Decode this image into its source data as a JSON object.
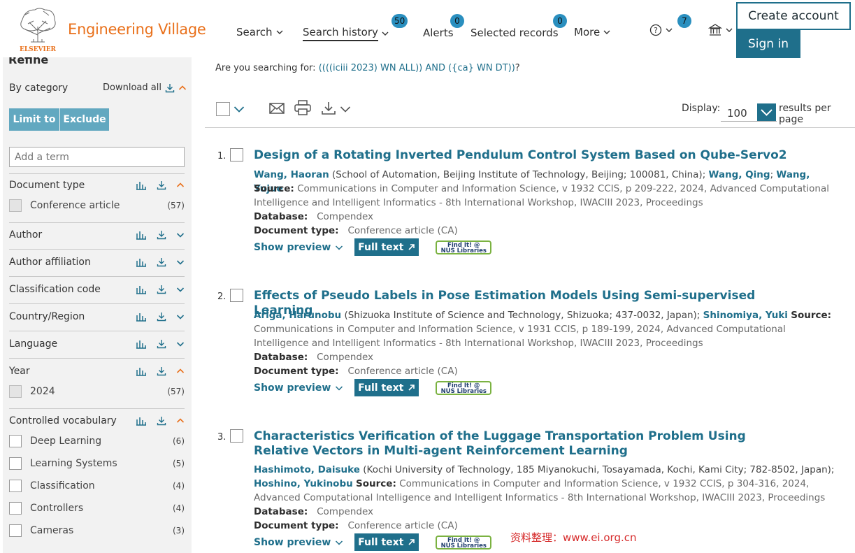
{
  "header": {
    "publisher": "ELSEVIER",
    "brand": "Engineering Village",
    "nav": {
      "search": "Search",
      "search_history": "Search history",
      "search_history_count": "50",
      "alerts": "Alerts",
      "alerts_count": "0",
      "selected_records": "Selected records",
      "selected_records_count": "0",
      "more": "More",
      "help_count": "7"
    },
    "create_account": "Create account",
    "sign_in": "Sign in"
  },
  "sidebar": {
    "title": "Refine",
    "by_category": "By category",
    "download_all": "Download all",
    "limit_to": "Limit to",
    "exclude": "Exclude",
    "add_term_placeholder": "Add a term",
    "facets": {
      "document_type": {
        "title": "Document type",
        "items": [
          {
            "label": "Conference article",
            "count": "(57)"
          }
        ]
      },
      "author": {
        "title": "Author"
      },
      "author_affiliation": {
        "title": "Author affiliation"
      },
      "classification_code": {
        "title": "Classification code"
      },
      "country_region": {
        "title": "Country/Region"
      },
      "language": {
        "title": "Language"
      },
      "year": {
        "title": "Year",
        "items": [
          {
            "label": "2024",
            "count": "(57)"
          }
        ]
      },
      "controlled_vocabulary": {
        "title": "Controlled vocabulary",
        "items": [
          {
            "label": "Deep Learning",
            "count": "(6)"
          },
          {
            "label": "Learning Systems",
            "count": "(5)"
          },
          {
            "label": "Classification",
            "count": "(4)"
          },
          {
            "label": "Controllers",
            "count": "(4)"
          },
          {
            "label": "Cameras",
            "count": "(3)"
          }
        ]
      }
    }
  },
  "main": {
    "suggest_prefix": "Are you searching for: ",
    "suggest_query": "((((iciii 2023) WN ALL)) AND ({ca} WN DT))",
    "suggest_suffix": "?",
    "display_label": "Display:",
    "display_value": "100",
    "per_page_label": "results per page",
    "labels": {
      "source": "Source:",
      "database": "Database:",
      "document_type": "Document type:",
      "show_preview": "Show preview",
      "full_text": "Full text",
      "findit_line1": "Find It! @",
      "findit_line2": "NUS Libraries"
    },
    "results": [
      {
        "num": "1.",
        "title": "Design of a Rotating Inverted Pendulum Control System Based on Qube-Servo2",
        "author1": "Wang, Haoran",
        "affil": " (School of Automation, Beijing Institute of Technology, Beijing; 100081, China); ",
        "author2": "Wang, Qing",
        "sep": "; ",
        "author3": "Wang, Yujue",
        "source_text": "Communications in Computer and Information Science, v 1932 CCIS, p 209-222, 2024, ",
        "source_text2": "Advanced Computational Intelligence and Intelligent Informatics - 8th International Workshop, IWACIII 2023, Proceedings",
        "database": "Compendex",
        "doctype": "Conference article (CA)"
      },
      {
        "num": "2.",
        "title": "Effects of Pseudo Labels in Pose Estimation Models Using Semi-supervised Learning",
        "author1": "Ariga, Harunobu",
        "affil": " (Shizuoka Institute of Science and Technology, Shizuoka; 437-0032, Japan); ",
        "author2": "Shinomiya, Yuki",
        "source_text": "Communications in Computer and Information Science, v 1931 CCIS, p 189-199, 2024, ",
        "source_text2": "Advanced Computational Intelligence and Intelligent Informatics - 8th International Workshop, IWACIII 2023, Proceedings",
        "database": "Compendex",
        "doctype": "Conference article (CA)"
      },
      {
        "num": "3.",
        "title": "Characteristics Verification of the Luggage Transportation Problem Using Relative Vectors in Multi-agent Reinforcement Learning",
        "author1": "Hashimoto, Daisuke",
        "affil": " (Kochi University of Technology, 185 Miyanokuchi, Tosayamada, Kochi, Kami City; 782-8502, Japan);",
        "author2": "Hoshino, Yukinobu",
        "source_text": "Communications in Computer and Information Science, v 1932 CCIS, p 304-316, 2024, ",
        "source_text2": "Advanced Computational Intelligence and Intelligent Informatics - 8th International Workshop, IWACIII 2023, Proceedings",
        "database": "Compendex",
        "doctype": "Conference article (CA)"
      }
    ]
  },
  "watermark": "资料整理：www.ei.org.cn",
  "colors": {
    "brand_orange": "#e9711c",
    "primary_teal": "#1f6f8b",
    "button_light": "#62a8c0",
    "badge_blue": "#2a8fbf",
    "findit_green": "#7bb241"
  }
}
